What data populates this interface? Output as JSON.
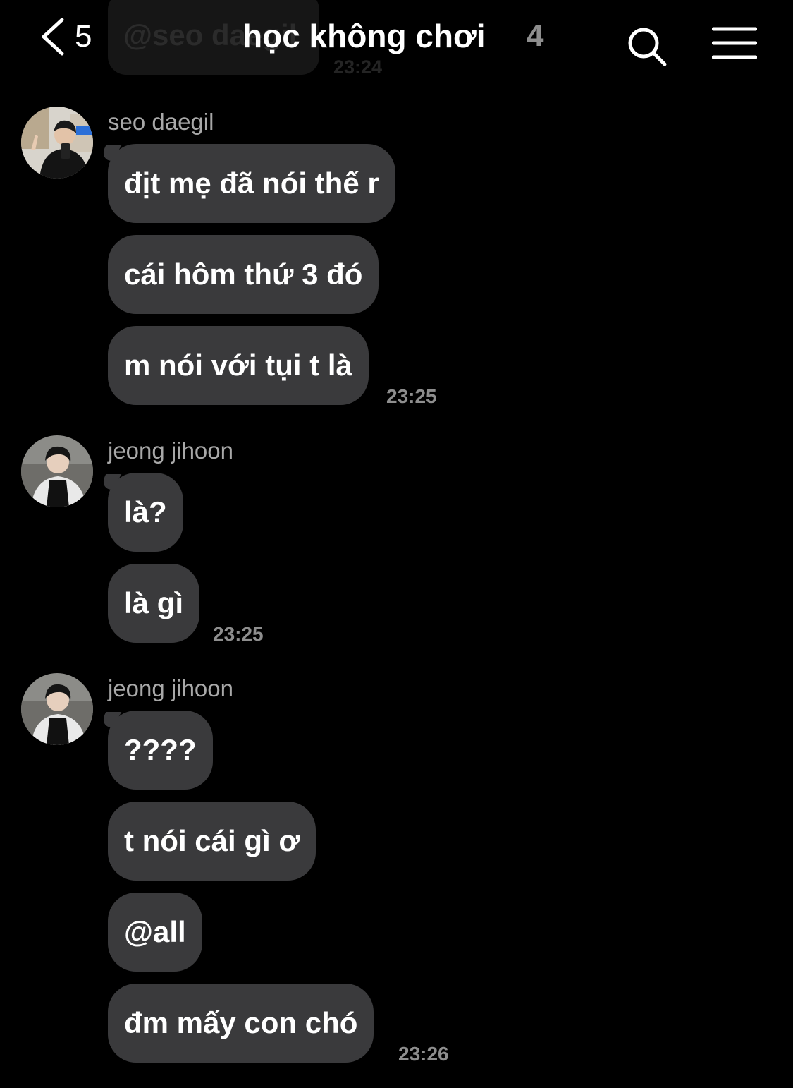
{
  "header": {
    "back_count": "5",
    "title": "học không chơi",
    "member_count": "4",
    "icons": [
      "chevron-left-icon",
      "search-icon",
      "menu-icon"
    ]
  },
  "previous_message": {
    "text": "@seo daegil",
    "time": "23:24"
  },
  "groups": [
    {
      "sender": "seo daegil",
      "messages": [
        "địt mẹ đã nói thế r",
        "cái hôm thứ 3 đó",
        "m nói với tụi t là"
      ],
      "time": "23:25"
    },
    {
      "sender": "jeong jihoon",
      "messages": [
        "là?",
        "là gì"
      ],
      "time": "23:25"
    },
    {
      "sender": "jeong jihoon",
      "messages": [
        "????",
        "t nói cái gì ơ",
        "@all",
        "đm mấy con chó"
      ],
      "time": "23:26"
    }
  ],
  "colors": {
    "background": "#000000",
    "bubble": "#3a3a3c",
    "text": "#ffffff",
    "secondary_text": "#8e8e8e"
  }
}
